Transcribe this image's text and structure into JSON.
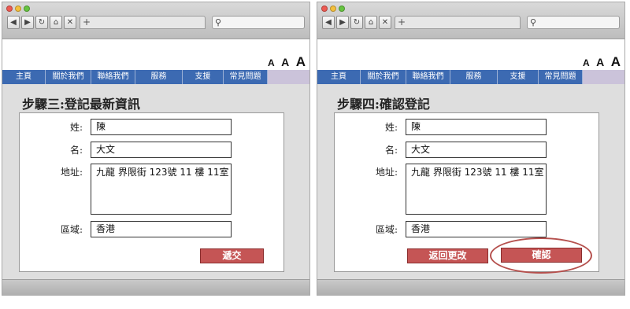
{
  "colors": {
    "nav_bg": "#3c6ab2",
    "nav_strip": "#cbc3da",
    "button": "#c55555",
    "highlight": "#b5504d",
    "light_close": "#ee5a52",
    "light_min": "#f4bf3c",
    "light_max": "#66c440"
  },
  "browser": {
    "back_glyph": "◀",
    "forward_glyph": "▶",
    "reload_glyph": "↻",
    "home_glyph": "⌂",
    "stop_glyph": "✕",
    "newtab_glyph": "+",
    "search_glyph": "⚲"
  },
  "font_sizes": [
    "A",
    "A",
    "A"
  ],
  "nav": [
    "主頁",
    "關於我們",
    "聯絡我們",
    "服務",
    "支援",
    "常見問題"
  ],
  "labels": {
    "surname": "姓:",
    "given_name": "名:",
    "address": "地址:",
    "region": "區域:"
  },
  "values": {
    "surname": "陳",
    "given_name": "大文",
    "address": "九龍 界限街 123號 11 樓 11室",
    "region": "香港"
  },
  "left_panel": {
    "title": "步驟三:登記最新資訊",
    "submit_label": "遞交"
  },
  "right_panel": {
    "title": "步驟四:確認登記",
    "back_label": "返回更改",
    "confirm_label": "確認"
  }
}
